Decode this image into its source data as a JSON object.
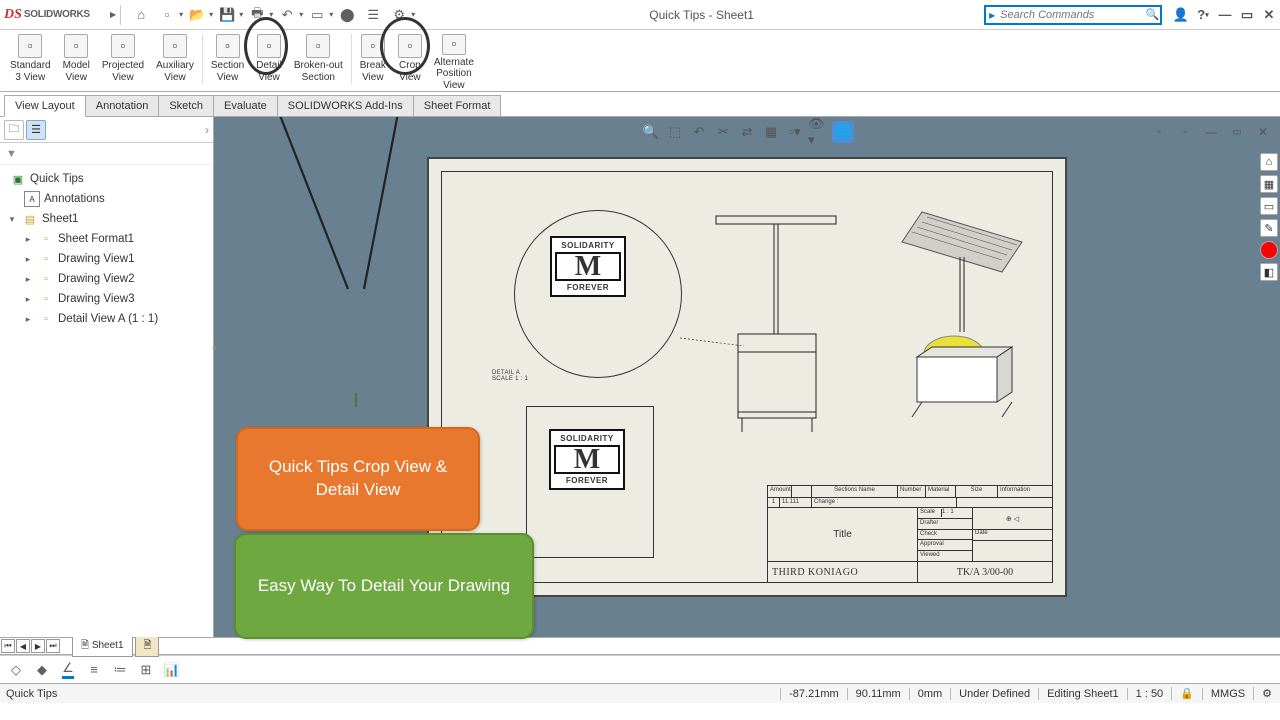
{
  "titlebar": {
    "logo_text": "SOLIDWORKS",
    "doc_title": "Quick Tips - Sheet1",
    "search_placeholder": "Search Commands"
  },
  "quick_access": [
    {
      "name": "home-icon",
      "glyph": "⌂"
    },
    {
      "name": "new-icon",
      "glyph": "▫"
    },
    {
      "name": "open-icon",
      "glyph": "📂"
    },
    {
      "name": "save-icon",
      "glyph": "💾"
    },
    {
      "name": "print-icon",
      "glyph": "🖶"
    },
    {
      "name": "undo-icon",
      "glyph": "↶"
    },
    {
      "name": "select-icon",
      "glyph": "▭"
    },
    {
      "name": "rebuild-icon",
      "glyph": "⬤"
    },
    {
      "name": "options-icon",
      "glyph": "☰"
    },
    {
      "name": "settings-icon",
      "glyph": "⚙"
    }
  ],
  "ribbon_tabs": [
    "View Layout",
    "Annotation",
    "Sketch",
    "Evaluate",
    "SOLIDWORKS Add-Ins",
    "Sheet Format"
  ],
  "ribbon_items": [
    {
      "l1": "Standard",
      "l2": "3 View"
    },
    {
      "l1": "Model",
      "l2": "View"
    },
    {
      "l1": "Projected",
      "l2": "View"
    },
    {
      "l1": "Auxiliary",
      "l2": "View"
    },
    {
      "l1": "Section",
      "l2": "View"
    },
    {
      "l1": "Detail",
      "l2": "View"
    },
    {
      "l1": "Broken-out",
      "l2": "Section"
    },
    {
      "l1": "Break",
      "l2": "View"
    },
    {
      "l1": "Crop",
      "l2": "View"
    },
    {
      "l1": "Alternate",
      "l2": "Position",
      "l3": "View"
    }
  ],
  "tree": {
    "root": "Quick Tips",
    "annotations": "Annotations",
    "sheet": "Sheet1",
    "children": [
      "Sheet Format1",
      "Drawing View1",
      "Drawing View2",
      "Drawing View3",
      "Detail View A (1 : 1)"
    ]
  },
  "callouts": {
    "orange": "Quick Tips Crop View & Detail View",
    "green": "Easy Way To Detail Your Drawing"
  },
  "drawing": {
    "detail_label_1": "DETAIL A",
    "detail_label_2": "SCALE 1 : 1",
    "logo_top": "SOLIDARITY",
    "logo_big": "M",
    "logo_bot": "FOREVER",
    "titleblock": {
      "title_label": "Title",
      "author": "THIRD KONIAGO",
      "code": "TK/A 3/00-00",
      "hdr": [
        "Amount",
        "",
        "Sections Name",
        "Number",
        "Material",
        "Size",
        "Information"
      ],
      "row2": [
        "1",
        "11.111",
        "Change :"
      ],
      "side": [
        "Scale",
        "Drafter",
        "Check",
        "Approval",
        "Viewed"
      ],
      "scale_val": "1 : 1",
      "date_hdr": "Date"
    }
  },
  "sheet_tab": "Sheet1",
  "status": {
    "left": "Quick Tips",
    "coord_x": "-87.21mm",
    "coord_y": "90.11mm",
    "coord_z": "0mm",
    "defined": "Under Defined",
    "editing": "Editing Sheet1",
    "scale": "1 : 50",
    "units": "MMGS"
  }
}
